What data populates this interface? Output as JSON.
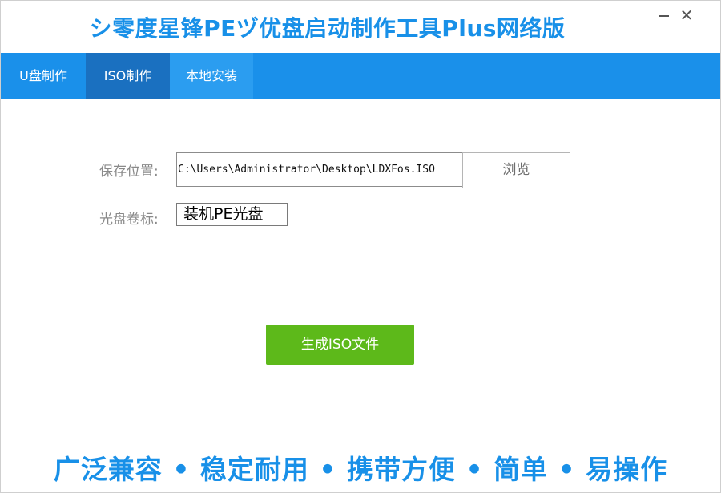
{
  "window": {
    "title": "シ零度星锋PEヅ优盘启动制作工具Plus网络版"
  },
  "tabs": [
    {
      "label": "U盘制作"
    },
    {
      "label": "ISO制作"
    },
    {
      "label": "本地安装"
    }
  ],
  "form": {
    "save_label": "保存位置:",
    "save_path": "C:\\Users\\Administrator\\Desktop\\LDXFos.ISO",
    "browse_label": "浏览",
    "volume_label": "光盘卷标:",
    "volume_value": "装机PE光盘"
  },
  "actions": {
    "generate_label": "生成ISO文件"
  },
  "footer": {
    "slogan": "广泛兼容 • 稳定耐用 • 携带方便 • 简单 • 易操作"
  },
  "colors": {
    "brand_blue": "#1890e8",
    "tab_bar": "#1a90ea",
    "tab_active": "#1a70c0",
    "primary_green": "#5db91a"
  },
  "icons": {
    "minimize": "minimize-icon",
    "close": "close-icon"
  }
}
